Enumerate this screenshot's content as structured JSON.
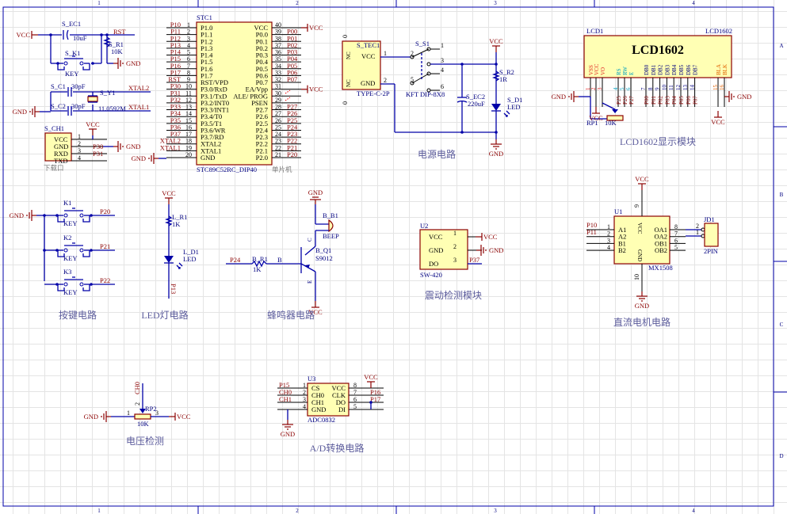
{
  "frame": {
    "columns": [
      "1",
      "2",
      "3",
      "4"
    ],
    "rows": [
      "A",
      "B",
      "C",
      "D"
    ]
  },
  "power": {
    "vcc": "VCC",
    "gnd": "GND"
  },
  "reset": {
    "cap_ref": "S_EC1",
    "cap_val": "10uF",
    "net": "RST",
    "res_ref": "S_R1",
    "res_val": "10K",
    "key_ref": "S_K1",
    "key_val": "KEY"
  },
  "crystal": {
    "c1_ref": "S_C1",
    "c1_val": "30pF",
    "c2_ref": "S_C2",
    "c2_val": "30pF",
    "y_ref": "S_Y1",
    "y_val": "11.0592M",
    "net2": "XTAL2",
    "net1": "XTAL1"
  },
  "download": {
    "ref": "S_CH1",
    "caption": "下载口",
    "pins": [
      {
        "num": "1",
        "name": "VCC"
      },
      {
        "num": "2",
        "name": "GND"
      },
      {
        "num": "3",
        "name": "RXD"
      },
      {
        "num": "4",
        "name": "TXD"
      }
    ],
    "nets": [
      "P30",
      "P31"
    ]
  },
  "mcu": {
    "ref": "STC1",
    "part": "STC89C52RC_DIP40",
    "comment": "单片机",
    "left_pins": [
      {
        "num": "1",
        "name": "P1.0",
        "net": "P10"
      },
      {
        "num": "2",
        "name": "P1.1",
        "net": "P11"
      },
      {
        "num": "3",
        "name": "P1.2",
        "net": "P12"
      },
      {
        "num": "4",
        "name": "P1.3",
        "net": "P13"
      },
      {
        "num": "5",
        "name": "P1.4",
        "net": "P14"
      },
      {
        "num": "6",
        "name": "P1.5",
        "net": "P15"
      },
      {
        "num": "7",
        "name": "P1.6",
        "net": "P16"
      },
      {
        "num": "8",
        "name": "P1.7",
        "net": "P17"
      },
      {
        "num": "9",
        "name": "RST/VPD",
        "net": "RST"
      },
      {
        "num": "10",
        "name": "P3.0/RxD",
        "net": "P30"
      },
      {
        "num": "11",
        "name": "P3.1/TxD",
        "net": "P31"
      },
      {
        "num": "12",
        "name": "P3.2/INT0",
        "net": "P32"
      },
      {
        "num": "13",
        "name": "P3.3/INT1",
        "net": "P33"
      },
      {
        "num": "14",
        "name": "P3.4/T0",
        "net": "P34"
      },
      {
        "num": "15",
        "name": "P3.5/T1",
        "net": "P35"
      },
      {
        "num": "16",
        "name": "P3.6/WR",
        "net": "P36"
      },
      {
        "num": "17",
        "name": "P3.7/RD",
        "net": "P37"
      },
      {
        "num": "18",
        "name": "XTAL2",
        "net": "XTAL2"
      },
      {
        "num": "19",
        "name": "XTAL1",
        "net": "XTAL1"
      },
      {
        "num": "20",
        "name": "GND",
        "net": "GND"
      }
    ],
    "right_pins": [
      {
        "num": "40",
        "name": "VCC",
        "net": "VCC"
      },
      {
        "num": "39",
        "name": "P0.0",
        "net": "P00"
      },
      {
        "num": "38",
        "name": "P0.1",
        "net": "P01"
      },
      {
        "num": "37",
        "name": "P0.2",
        "net": "P02"
      },
      {
        "num": "36",
        "name": "P0.3",
        "net": "P03"
      },
      {
        "num": "35",
        "name": "P0.4",
        "net": "P04"
      },
      {
        "num": "34",
        "name": "P0.5",
        "net": "P05"
      },
      {
        "num": "33",
        "name": "P0.6",
        "net": "P06"
      },
      {
        "num": "32",
        "name": "P0.7",
        "net": "P07"
      },
      {
        "num": "31",
        "name": "EA/Vpp",
        "net": "VCC"
      },
      {
        "num": "30",
        "name": "ALE/ PROG",
        "net": ""
      },
      {
        "num": "29",
        "name": "PSEN",
        "net": ""
      },
      {
        "num": "28",
        "name": "P2.7",
        "net": "P27"
      },
      {
        "num": "27",
        "name": "P2.6",
        "net": "P26"
      },
      {
        "num": "26",
        "name": "P2.5",
        "net": "P25"
      },
      {
        "num": "25",
        "name": "P2.4",
        "net": "P24"
      },
      {
        "num": "24",
        "name": "P2.3",
        "net": "P23"
      },
      {
        "num": "23",
        "name": "P2.2",
        "net": "P22"
      },
      {
        "num": "22",
        "name": "P2.1",
        "net": "P21"
      },
      {
        "num": "21",
        "name": "P2.0",
        "net": "P20"
      }
    ]
  },
  "power_circuit": {
    "title": "电源电路",
    "tec_ref": "S_TEC1",
    "tec_val": "TYPE-C-2P",
    "tec_pins": [
      {
        "num": "1",
        "name": "VCC"
      },
      {
        "num": "2",
        "name": "GND"
      }
    ],
    "nc": "NC",
    "zero": "0",
    "sw_ref": "S_S1",
    "sw_val": "KFT DIP-8X8",
    "sw_pins": [
      "1",
      "2",
      "3",
      "4",
      "5",
      "6"
    ],
    "r_ref": "S_R2",
    "r_val": "1R",
    "c_ref": "S_EC2",
    "c_val": "220uF",
    "d_ref": "S_D1",
    "d_val": "LED"
  },
  "lcd": {
    "ref": "LCD1",
    "part": "LCD1602",
    "body": "LCD1602",
    "caption": "LCD1602显示模块",
    "rp_ref": "RP1",
    "rp_val": "10K",
    "pins": [
      {
        "num": "1",
        "name": "VSS"
      },
      {
        "num": "2",
        "name": "VCC"
      },
      {
        "num": "3",
        "name": "VO"
      },
      {
        "num": "4",
        "name": "RS"
      },
      {
        "num": "5",
        "name": "RW"
      },
      {
        "num": "6",
        "name": "E"
      },
      {
        "num": "7",
        "name": "DB0"
      },
      {
        "num": "8",
        "name": "DB1"
      },
      {
        "num": "9",
        "name": "DB2"
      },
      {
        "num": "10",
        "name": "DB3"
      },
      {
        "num": "11",
        "name": "DB4"
      },
      {
        "num": "12",
        "name": "DB5"
      },
      {
        "num": "13",
        "name": "DB6"
      },
      {
        "num": "14",
        "name": "DB7"
      },
      {
        "num": "15",
        "name": "BLA"
      },
      {
        "num": "16",
        "name": "BLK"
      }
    ],
    "nets": [
      "P25",
      "P26",
      "P27",
      "P00",
      "P01",
      "P02",
      "P03",
      "P04",
      "P05",
      "P06",
      "P07"
    ]
  },
  "keys": {
    "title": "按键电路",
    "items": [
      {
        "ref": "K1",
        "val": "KEY",
        "net": "P20"
      },
      {
        "ref": "K2",
        "val": "KEY",
        "net": "P21"
      },
      {
        "ref": "K3",
        "val": "KEY",
        "net": "P22"
      }
    ]
  },
  "led": {
    "title": "LED灯电路",
    "r_ref": "L_R1",
    "r_val": "1K",
    "d_ref": "L_D1",
    "d_val": "LED",
    "net": "P13"
  },
  "buzzer": {
    "title": "蜂鸣器电路",
    "b_ref": "B_B1",
    "b_val": "BEEP",
    "q_ref": "B_Q1",
    "q_val": "S9012",
    "r_ref": "B_R1",
    "r_val": "1K",
    "net": "P24",
    "base": "B",
    "collector": "C",
    "emitter": "E"
  },
  "vibration": {
    "title": "震动检测模块",
    "ref": "U2",
    "part": "SW-420",
    "pins": [
      {
        "num": "1",
        "name": "VCC"
      },
      {
        "num": "2",
        "name": "GND"
      },
      {
        "num": "3",
        "name": "DO"
      }
    ],
    "net": "P37"
  },
  "motor": {
    "title": "直流电机电路",
    "ref": "U1",
    "part": "MX1508",
    "left": [
      {
        "num": "1",
        "name": "A1"
      },
      {
        "num": "2",
        "name": "A2"
      },
      {
        "num": "3",
        "name": "B1"
      },
      {
        "num": "4",
        "name": "B2"
      }
    ],
    "right": [
      {
        "num": "8",
        "name": "OA1"
      },
      {
        "num": "7",
        "name": "OA2"
      },
      {
        "num": "6",
        "name": "OB1"
      },
      {
        "num": "5",
        "name": "OB2"
      }
    ],
    "vcc_pin": "9",
    "gnd_pin": "10",
    "nets": [
      "P10",
      "P11"
    ],
    "jd_ref": "JD1",
    "jd_val": "2PIN",
    "jd_pins": [
      "2",
      "1"
    ]
  },
  "voltage": {
    "title": "电压检测",
    "ref": "RP2",
    "val": "10K",
    "net": "CH0",
    "pins": [
      "1",
      "2",
      "3"
    ]
  },
  "adc": {
    "title": "A/D转换电路",
    "ref": "U3",
    "part": "ADC0832",
    "left": [
      {
        "num": "1",
        "name": "CS",
        "net": "P15"
      },
      {
        "num": "2",
        "name": "CH0",
        "net": "CH0"
      },
      {
        "num": "3",
        "name": "CH1",
        "net": "CH1"
      },
      {
        "num": "4",
        "name": "GND",
        "net": ""
      }
    ],
    "right": [
      {
        "num": "8",
        "name": "VCC",
        "net": ""
      },
      {
        "num": "7",
        "name": "CLK",
        "net": "P16"
      },
      {
        "num": "6",
        "name": "DO",
        "net": "P17"
      },
      {
        "num": "5",
        "name": "DI",
        "net": ""
      }
    ]
  }
}
